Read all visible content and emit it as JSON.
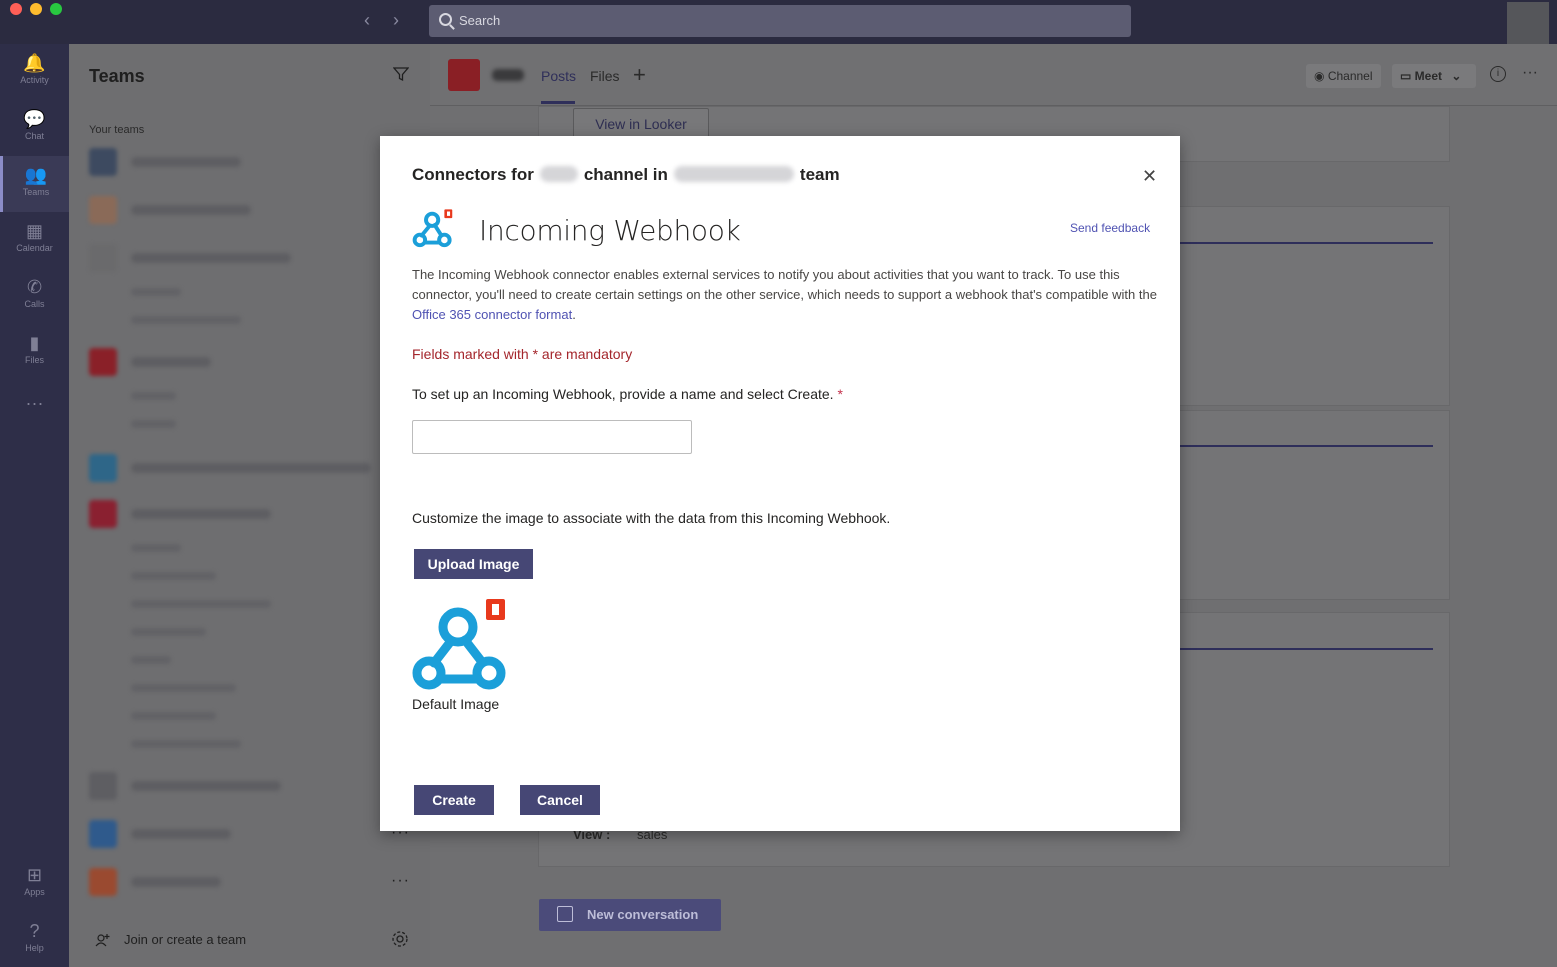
{
  "titlebar": {
    "search_placeholder": "Search",
    "back_glyph": "‹",
    "forward_glyph": "›"
  },
  "rail": {
    "items": [
      {
        "label": "Activity",
        "icon": "bell-icon",
        "glyph": "🔔"
      },
      {
        "label": "Chat",
        "icon": "chat-icon",
        "glyph": "💬"
      },
      {
        "label": "Teams",
        "icon": "teams-icon",
        "glyph": "👥"
      },
      {
        "label": "Calendar",
        "icon": "calendar-icon",
        "glyph": "▦"
      },
      {
        "label": "Calls",
        "icon": "phone-icon",
        "glyph": "✆"
      },
      {
        "label": "Files",
        "icon": "file-icon",
        "glyph": "▮"
      },
      {
        "label": "",
        "icon": "more-icon",
        "glyph": "···"
      },
      {
        "label": "Apps",
        "icon": "apps-icon",
        "glyph": "⊞"
      },
      {
        "label": "Help",
        "icon": "help-icon",
        "glyph": "?"
      }
    ]
  },
  "teams_panel": {
    "title": "Teams",
    "section_label": "Your teams",
    "join_label": "Join or create a team",
    "more_glyph": "···"
  },
  "channel_header": {
    "tabs": [
      "Posts",
      "Files"
    ],
    "add_tab_glyph": "+",
    "channel_chip": "Channel",
    "meet_label": "Meet",
    "info_glyph": "i",
    "more_glyph": "···"
  },
  "posts": {
    "view_in_looker": "View in Looker",
    "view_label": "View :",
    "view_value": "sales",
    "new_conversation": "New conversation"
  },
  "modal": {
    "title_prefix": "Connectors for",
    "title_middle": "channel in",
    "title_suffix": "team",
    "close_glyph": "✕",
    "connector_name": "Incoming Webhook",
    "send_feedback": "Send feedback",
    "description_prefix": "The Incoming Webhook connector enables external services to notify you about activities that you want to track. To use this connector, you'll need to create certain settings on the other service, which needs to support a webhook that's compatible with the ",
    "description_link": "Office 365 connector format",
    "description_suffix": ".",
    "mandatory_note": "Fields marked with * are mandatory",
    "setup_label": "To set up an Incoming Webhook, provide a name and select Create.",
    "required_star": "*",
    "name_value": "",
    "customize_label": "Customize the image to associate with the data from this Incoming Webhook.",
    "upload_button": "Upload Image",
    "default_image_label": "Default Image",
    "create_button": "Create",
    "cancel_button": "Cancel"
  },
  "colors": {
    "accent": "#464775",
    "link": "#4f52b2",
    "error": "#a4262c",
    "webhook_blue": "#1b9fd9",
    "office_red": "#e8391d"
  }
}
